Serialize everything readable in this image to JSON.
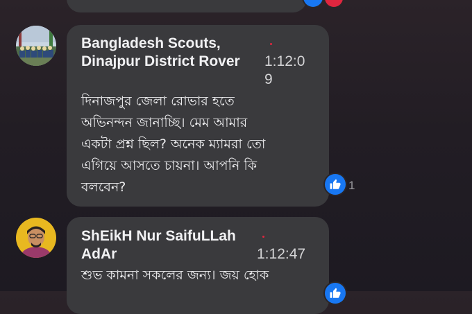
{
  "colors": {
    "bubble": "#3a3a3d",
    "like_blue": "#1877f2",
    "dot_red": "#e0263f"
  },
  "top_comment": {
    "text_fragment": "... ..."
  },
  "comments": [
    {
      "author_line1": "Bangladesh Scouts,",
      "author_line2": "Dinajpur District Rover",
      "time_line1": "1:12:0",
      "time_line2": "9",
      "text": "দিনাজপুর জেলা রোভার হতে\nঅভিনন্দন জানাচ্ছি। মেম আমার\nএকটা প্রশ্ন ছিল? অনেক ম্যামরা তো\nএগিয়ে আসতে চায়না। আপনি কি\nবলবেন?",
      "likes": "1"
    },
    {
      "author_line1": "ShEikH Nur SaifuLLah",
      "author_line2": "AdAr",
      "time": "1:12:47",
      "text": "শুভ কামনা সকলের জন্য। জয় হোক"
    }
  ]
}
